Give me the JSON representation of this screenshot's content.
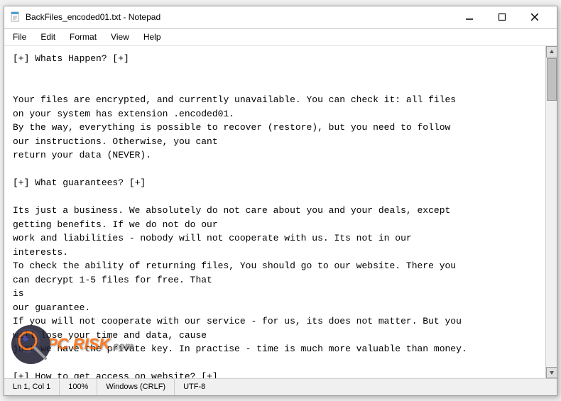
{
  "window": {
    "title": "BackFiles_encoded01.txt - Notepad",
    "icon": "notepad-icon"
  },
  "menu": {
    "items": [
      "File",
      "Edit",
      "Format",
      "View",
      "Help"
    ]
  },
  "content": {
    "text": "[+] Whats Happen? [+]\n\n\nYour files are encrypted, and currently unavailable. You can check it: all files\non your system has extension .encoded01.\nBy the way, everything is possible to recover (restore), but you need to follow\nour instructions. Otherwise, you cant\nreturn your data (NEVER).\n\n[+] What guarantees? [+]\n\nIts just a business. We absolutely do not care about you and your deals, except\ngetting benefits. If we do not do our\nwork and liabilities - nobody will not cooperate with us. Its not in our\ninterests.\nTo check the ability of returning files, You should go to our website. There you\ncan decrypt 1-5 files for free. That\nis\nour guarantee.\nIf you will not cooperate with our service - for us, its does not matter. But you\nwill lose your time and data, cause\njust we have the private key. In practise - time is much more valuable than money.\n\n[+] How to get access on website? [+]"
  },
  "status_bar": {
    "position": "Ln 1, Col 1",
    "zoom": "100%",
    "line_endings": "Windows (CRLF)",
    "encoding": "UTF-8"
  },
  "title_buttons": {
    "minimize": "–",
    "maximize": "□",
    "close": "✕"
  },
  "watermark": {
    "text": "PC RISK.COM"
  }
}
